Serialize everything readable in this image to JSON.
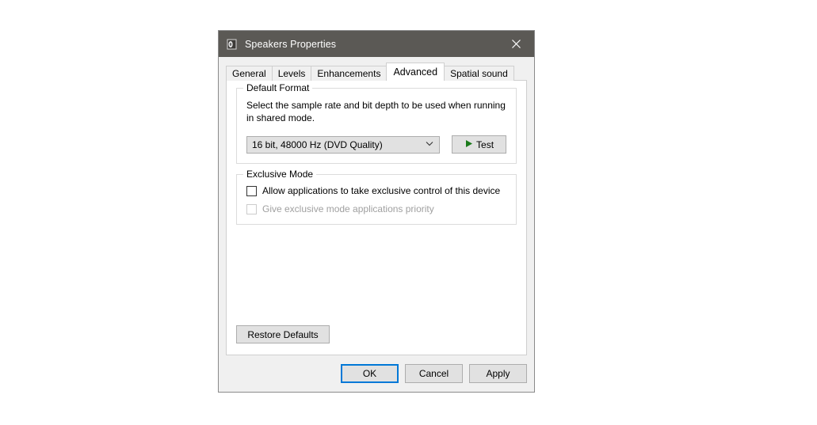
{
  "window": {
    "title": "Speakers Properties",
    "icon": "speaker-icon",
    "close_label": "✕",
    "titlebar_color": "#5b5955"
  },
  "tabs": [
    {
      "label": "General",
      "active": false
    },
    {
      "label": "Levels",
      "active": false
    },
    {
      "label": "Enhancements",
      "active": false
    },
    {
      "label": "Advanced",
      "active": true
    },
    {
      "label": "Spatial sound",
      "active": false
    }
  ],
  "default_format": {
    "group_label": "Default Format",
    "description": "Select the sample rate and bit depth to be used when running in shared mode.",
    "selected_option": "16 bit, 48000 Hz (DVD Quality)",
    "test_button_label": "Test",
    "test_icon_color": "#1a7a1a"
  },
  "exclusive_mode": {
    "group_label": "Exclusive Mode",
    "options": [
      {
        "label": "Allow applications to take exclusive control of this device",
        "checked": false,
        "disabled": false
      },
      {
        "label": "Give exclusive mode applications priority",
        "checked": false,
        "disabled": true
      }
    ]
  },
  "restore": {
    "label": "Restore Defaults"
  },
  "footer": {
    "ok_label": "OK",
    "cancel_label": "Cancel",
    "apply_label": "Apply",
    "focus_color": "#0078d7"
  }
}
